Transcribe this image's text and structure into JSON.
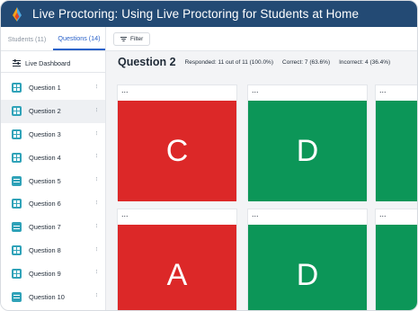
{
  "window": {
    "title": "Live Proctoring: Using Live Proctoring for Students at Home",
    "accent": "#234a74"
  },
  "sidebar": {
    "tabs": [
      {
        "label": "Students (11)",
        "active": false
      },
      {
        "label": "Questions (14)",
        "active": true
      }
    ],
    "dashboard_label": "Live Dashboard",
    "questions": [
      {
        "label": "Question 1",
        "icon": "grid-icon"
      },
      {
        "label": "Question 2",
        "icon": "grid-icon",
        "selected": true
      },
      {
        "label": "Question 3",
        "icon": "grid-icon"
      },
      {
        "label": "Question 4",
        "icon": "grid-icon"
      },
      {
        "label": "Question 5",
        "icon": "list-icon"
      },
      {
        "label": "Question 6",
        "icon": "grid-icon"
      },
      {
        "label": "Question 7",
        "icon": "list-icon"
      },
      {
        "label": "Question 8",
        "icon": "grid-icon"
      },
      {
        "label": "Question 9",
        "icon": "grid-icon"
      },
      {
        "label": "Question 10",
        "icon": "list-icon"
      }
    ]
  },
  "toolbar": {
    "filter_label": "Filter"
  },
  "summary": {
    "title": "Question 2",
    "responded": "Responded: 11 out of 11 (100.0%)",
    "correct": "Correct: 7 (63.6%)",
    "incorrect": "Incorrect: 4 (36.4%)"
  },
  "cards": [
    {
      "header": "...",
      "answer": "C",
      "status": "incorrect"
    },
    {
      "header": "...",
      "answer": "D",
      "status": "correct"
    },
    {
      "header": "...",
      "answer": "",
      "status": "correct"
    },
    {
      "header": "...",
      "answer": "A",
      "status": "incorrect"
    },
    {
      "header": "...",
      "answer": "D",
      "status": "correct"
    },
    {
      "header": "...",
      "answer": "",
      "status": "correct"
    }
  ],
  "colors": {
    "correct": "#0c9658",
    "incorrect": "#dc2828",
    "question_icon": "#2fa2b8"
  }
}
